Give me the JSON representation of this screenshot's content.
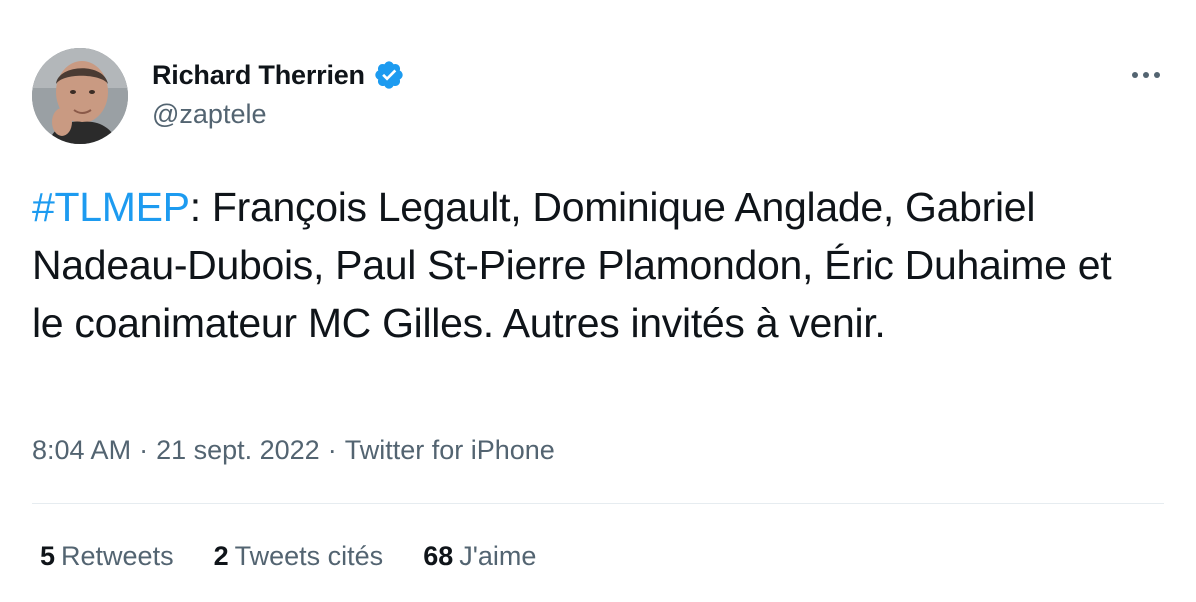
{
  "author": {
    "display_name": "Richard Therrien",
    "handle": "@zaptele",
    "verified": true,
    "verified_color": "#1d9bf0"
  },
  "tweet": {
    "hashtag": "#TLMEP",
    "body": ": François Legault, Dominique Anglade, Gabriel Nadeau-Dubois, Paul St-Pierre Plamondon, Éric Duhaime et le coanimateur MC Gilles. Autres invités à venir.",
    "time": "8:04 AM",
    "separator": "·",
    "date": "21 sept. 2022",
    "source": "Twitter for iPhone"
  },
  "stats": {
    "retweets_count": "5",
    "retweets_label": "Retweets",
    "quotes_count": "2",
    "quotes_label": "Tweets cités",
    "likes_count": "68",
    "likes_label": "J'aime"
  },
  "icons": {
    "more": "more-options-icon",
    "verified": "verified-badge-icon"
  },
  "colors": {
    "accent": "#1d9bf0",
    "text": "#0f1419",
    "secondary": "#536471"
  }
}
